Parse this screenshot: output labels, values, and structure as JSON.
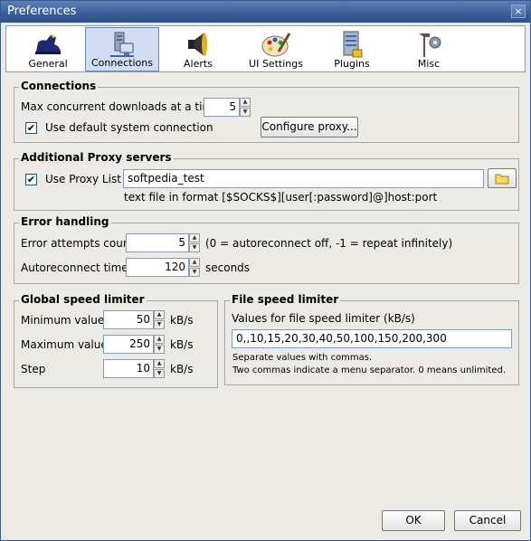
{
  "window": {
    "title": "Preferences",
    "close_glyph": "×"
  },
  "tabs": [
    {
      "label": "General",
      "icon": "boot-icon",
      "selected": false
    },
    {
      "label": "Connections",
      "icon": "network-computer-icon",
      "selected": true
    },
    {
      "label": "Alerts",
      "icon": "speaker-icon",
      "selected": false
    },
    {
      "label": "UI Settings",
      "icon": "palette-icon",
      "selected": false
    },
    {
      "label": "Plugins",
      "icon": "plugin-server-icon",
      "selected": false
    },
    {
      "label": "Misc",
      "icon": "tools-icon",
      "selected": false
    }
  ],
  "connections": {
    "legend": "Connections",
    "max_label": "Max concurrent downloads at a time",
    "max_value": "5",
    "default_conn_label": "Use default system connection",
    "default_conn_checked": true,
    "configure_proxy": "Configure proxy..."
  },
  "proxy": {
    "legend": "Additional Proxy servers",
    "use_list_label": "Use Proxy List",
    "use_list_checked": true,
    "list_value": "softpedia_test",
    "hint": "text file in format [$SOCKS$][user[:password]@]host:port"
  },
  "errors": {
    "legend": "Error handling",
    "attempts_label": "Error attempts count",
    "attempts_value": "5",
    "attempts_hint": "(0 = autoreconnect off, -1 = repeat infinitely)",
    "reconnect_label": "Autoreconnect time",
    "reconnect_value": "120",
    "reconnect_unit": "seconds"
  },
  "global_speed": {
    "legend": "Global speed limiter",
    "rows": [
      {
        "label": "Minimum value",
        "value": "50",
        "unit": "kB/s"
      },
      {
        "label": "Maximum value",
        "value": "250",
        "unit": "kB/s"
      },
      {
        "label": "Step",
        "value": "10",
        "unit": "kB/s"
      }
    ]
  },
  "file_speed": {
    "legend": "File speed limiter",
    "values_label": "Values for file speed limiter (kB/s)",
    "values": "0,,10,15,20,30,40,50,100,150,200,300",
    "note1": "Separate values with commas.",
    "note2": "Two commas indicate a menu separator. 0 means unlimited."
  },
  "footer": {
    "ok": "OK",
    "cancel": "Cancel"
  }
}
